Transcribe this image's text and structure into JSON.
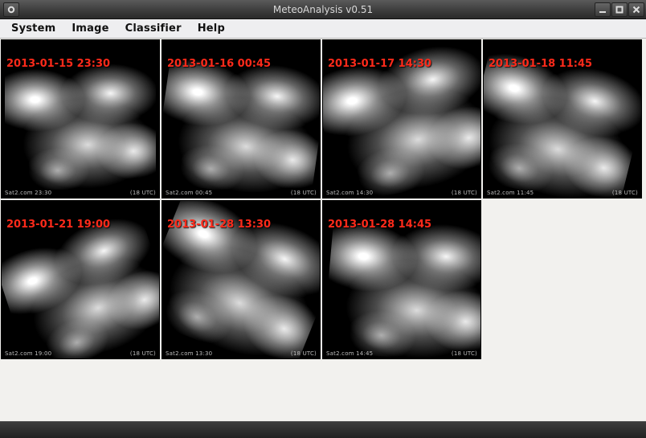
{
  "window": {
    "title": "MeteoAnalysis v0.51"
  },
  "menu": {
    "items": [
      {
        "label": "System"
      },
      {
        "label": "Image"
      },
      {
        "label": "Classifier"
      },
      {
        "label": "Help"
      }
    ]
  },
  "thumbnails": [
    {
      "timestamp": "2013-01-15 23:30",
      "footer_left": "Sat2.com 23:30",
      "footer_right": "(18 UTC)"
    },
    {
      "timestamp": "2013-01-16 00:45",
      "footer_left": "Sat2.com 00:45",
      "footer_right": "(18 UTC)"
    },
    {
      "timestamp": "2013-01-17 14:30",
      "footer_left": "Sat2.com 14:30",
      "footer_right": "(18 UTC)"
    },
    {
      "timestamp": "2013-01-18 11:45",
      "footer_left": "Sat2.com 11:45",
      "footer_right": "(18 UTC)"
    },
    {
      "timestamp": "2013-01-21 19:00",
      "footer_left": "Sat2.com 19:00",
      "footer_right": "(18 UTC)"
    },
    {
      "timestamp": "2013-01-28 13:30",
      "footer_left": "Sat2.com 13:30",
      "footer_right": "(18 UTC)"
    },
    {
      "timestamp": "2013-01-28 14:45",
      "footer_left": "Sat2.com 14:45",
      "footer_right": "(18 UTC)"
    }
  ]
}
